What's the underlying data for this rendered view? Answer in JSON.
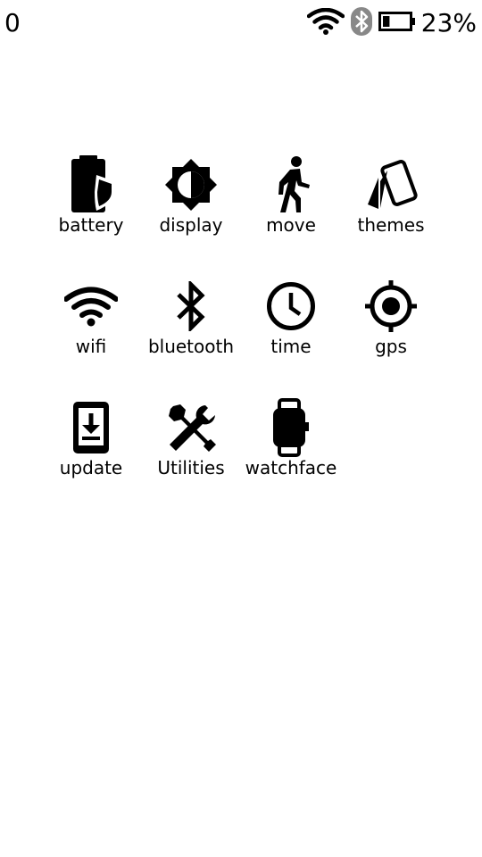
{
  "status_bar": {
    "left_text": "0",
    "battery_percent": "23%",
    "battery_level": 0.23,
    "icons": [
      "wifi-icon",
      "bluetooth-icon",
      "battery-icon"
    ]
  },
  "apps": [
    {
      "label": "battery",
      "icon": "battery-shield-icon"
    },
    {
      "label": "display",
      "icon": "brightness-icon"
    },
    {
      "label": "move",
      "icon": "walking-person-icon"
    },
    {
      "label": "themes",
      "icon": "cards-icon"
    },
    {
      "label": "wifi",
      "icon": "wifi-icon"
    },
    {
      "label": "bluetooth",
      "icon": "bluetooth-icon"
    },
    {
      "label": "time",
      "icon": "clock-icon"
    },
    {
      "label": "gps",
      "icon": "crosshair-icon"
    },
    {
      "label": "update",
      "icon": "phone-download-icon"
    },
    {
      "label": "Utilities",
      "icon": "tools-icon"
    },
    {
      "label": "watchface",
      "icon": "watch-icon"
    }
  ]
}
